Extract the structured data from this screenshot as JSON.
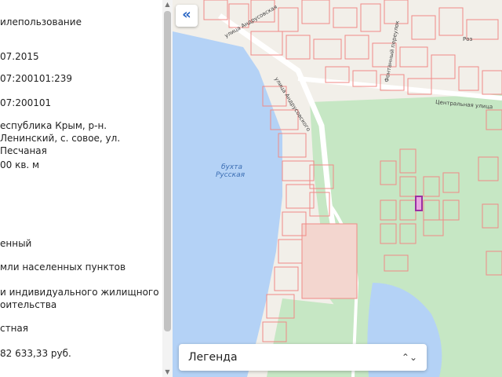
{
  "sidebar": {
    "rows": [
      "илепользование",
      "07.2015",
      "07:200101:239",
      "07:200101",
      "еспублика Крым, р-н. Ленинский, с. совое, ул. Песчаная",
      "00 кв. м",
      "енный",
      "мли населенных пунктов",
      "и индивидуального жилищного оительства",
      "стная",
      "82 633,33 руб."
    ]
  },
  "map": {
    "labels": {
      "bay_name": "бухта",
      "bay_name2": "Русская",
      "street1": "улица Андрусовская",
      "street2": "улица Андрусовского",
      "street3": "Центральная улица",
      "street4": "Фонтанный переулок",
      "street5": "Роз"
    },
    "colors": {
      "water": "#b4d2f6",
      "park": "#c6e7c4",
      "parcel_stroke": "#f08a86",
      "highlight": "#9b2fa3",
      "road": "#ffffff"
    }
  },
  "ui": {
    "collapse_icon": "«",
    "legend_label": "Легенда",
    "legend_chevron": "⌃⌄"
  }
}
